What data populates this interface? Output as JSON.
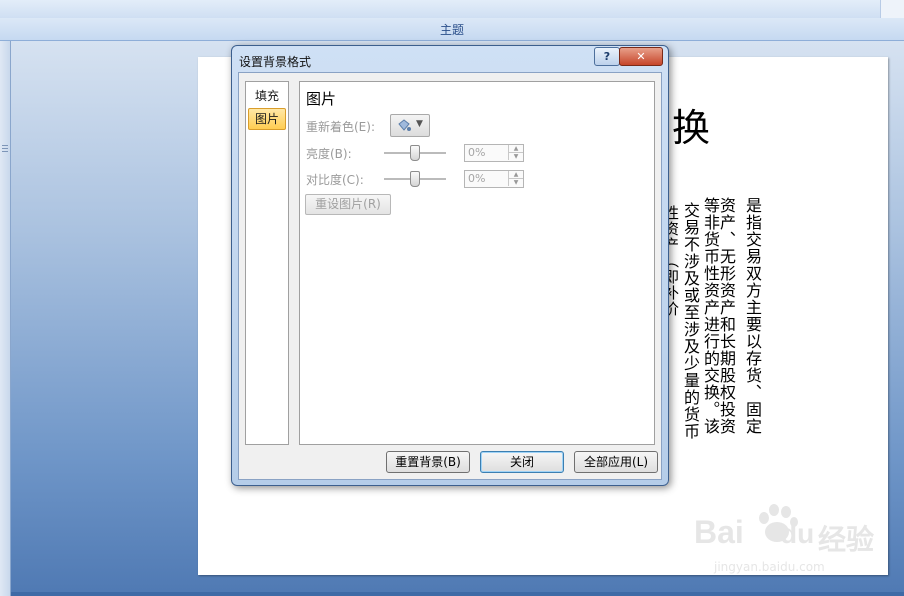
{
  "ribbon": {
    "group_label": "主题"
  },
  "slide": {
    "title_char": "换",
    "columns": [
      "是指交易双方主要以存货、固定",
      "资产、无形资产和长期股权投资",
      "等非货币性资产进行的交换。该",
      "交易不涉及或至涉及少量的货币",
      "性资产（即补价"
    ]
  },
  "watermark": {
    "brand": "Bai",
    "brand_suffix": "du",
    "brand_cn": "经验",
    "url": "jingyan.baidu.com"
  },
  "dialog": {
    "title": "设置背景格式",
    "help_glyph": "?",
    "close_glyph": "✕",
    "nav": {
      "items": [
        "填充",
        "图片"
      ],
      "active_index": 1
    },
    "panel": {
      "heading": "图片",
      "recolor_label": "重新着色(E):",
      "brightness_label": "亮度(B):",
      "brightness_value": "0%",
      "contrast_label": "对比度(C):",
      "contrast_value": "0%",
      "reset_picture_label": "重设图片(R)"
    },
    "footer": {
      "reset_bg_label": "重置背景(B)",
      "close_label": "关闭",
      "apply_all_label": "全部应用(L)"
    }
  },
  "icons": {
    "recolor": "paint-bucket-icon",
    "dropdown": "dropdown-arrow-icon",
    "spin_up": "spin-up-icon",
    "spin_down": "spin-down-icon"
  }
}
